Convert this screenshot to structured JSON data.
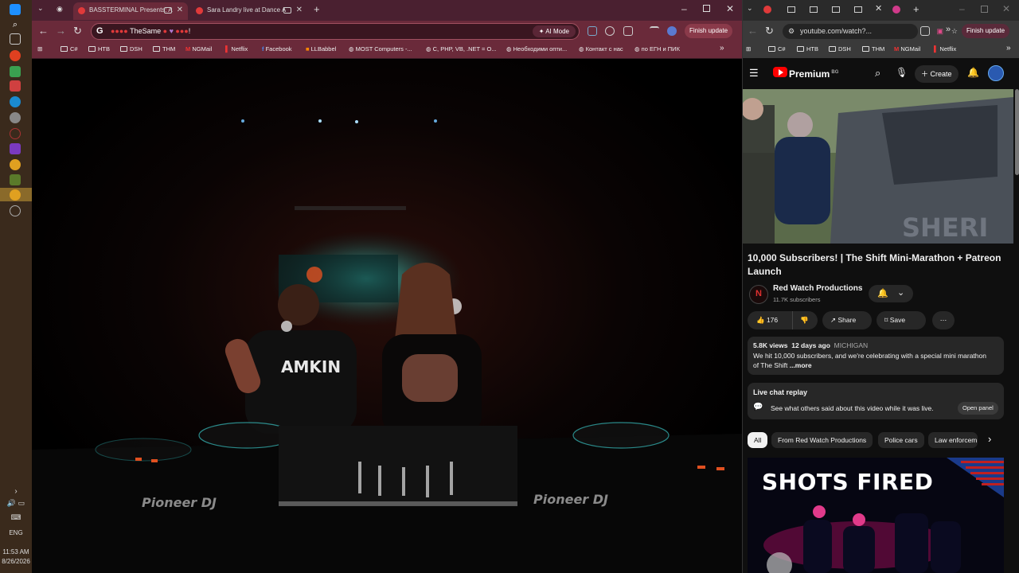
{
  "taskbar": {
    "language": "ENG",
    "time": "11:53 AM",
    "date": "8/26/2026"
  },
  "left_browser": {
    "tabs": [
      {
        "label": "BASSTERMINAL Presents: A"
      },
      {
        "label": "Sara Landry live at Dance A"
      }
    ],
    "omnibox_text": "TheSame",
    "ai_mode_label": "AI Mode",
    "finish_update_label": "Finish update",
    "bookmarks": [
      "C#",
      "HTB",
      "DSH",
      "THM",
      "NGMail",
      "Netflix",
      "Facebook",
      "LLBabbel",
      "MOST Computers -...",
      "C, PHP, VB, .NET = O...",
      "Необходими опти...",
      "Контакт с нас",
      "по ЕГН и ПИК"
    ],
    "video_brand_left": "Pioneer DJ",
    "video_brand_right": "Pioneer DJ",
    "shirt_text": "AMKIN"
  },
  "right_browser": {
    "url": "youtube.com/watch?...",
    "finish_update_label": "Finish update",
    "bookmarks": [
      "C#",
      "HTB",
      "DSH",
      "THM",
      "NGMail",
      "Netflix"
    ],
    "yt_brand": "Premium",
    "yt_brand_sup": "BG",
    "create_label": "Create",
    "video": {
      "title": "10,000 Subscribers! | The Shift Mini-Marathon + Patreon Launch",
      "channel": "Red Watch Productions",
      "subscribers": "11.7K subscribers",
      "likes": "176",
      "share_label": "Share",
      "save_label": "Save",
      "views": "5.8K views",
      "age": "12 days ago",
      "location": "MICHIGAN",
      "description": "We hit 10,000 subscribers, and we're celebrating with a special mini marathon of The Shift",
      "more_label": "...more",
      "thumb_text": "SHERI"
    },
    "live_chat": {
      "title": "Live chat replay",
      "text": "See what others said about this video while it was live.",
      "button": "Open panel"
    },
    "chips": [
      "All",
      "From Red Watch Productions",
      "Police cars",
      "Law enforcem"
    ],
    "rec_title": "SHOTS FIRED"
  }
}
